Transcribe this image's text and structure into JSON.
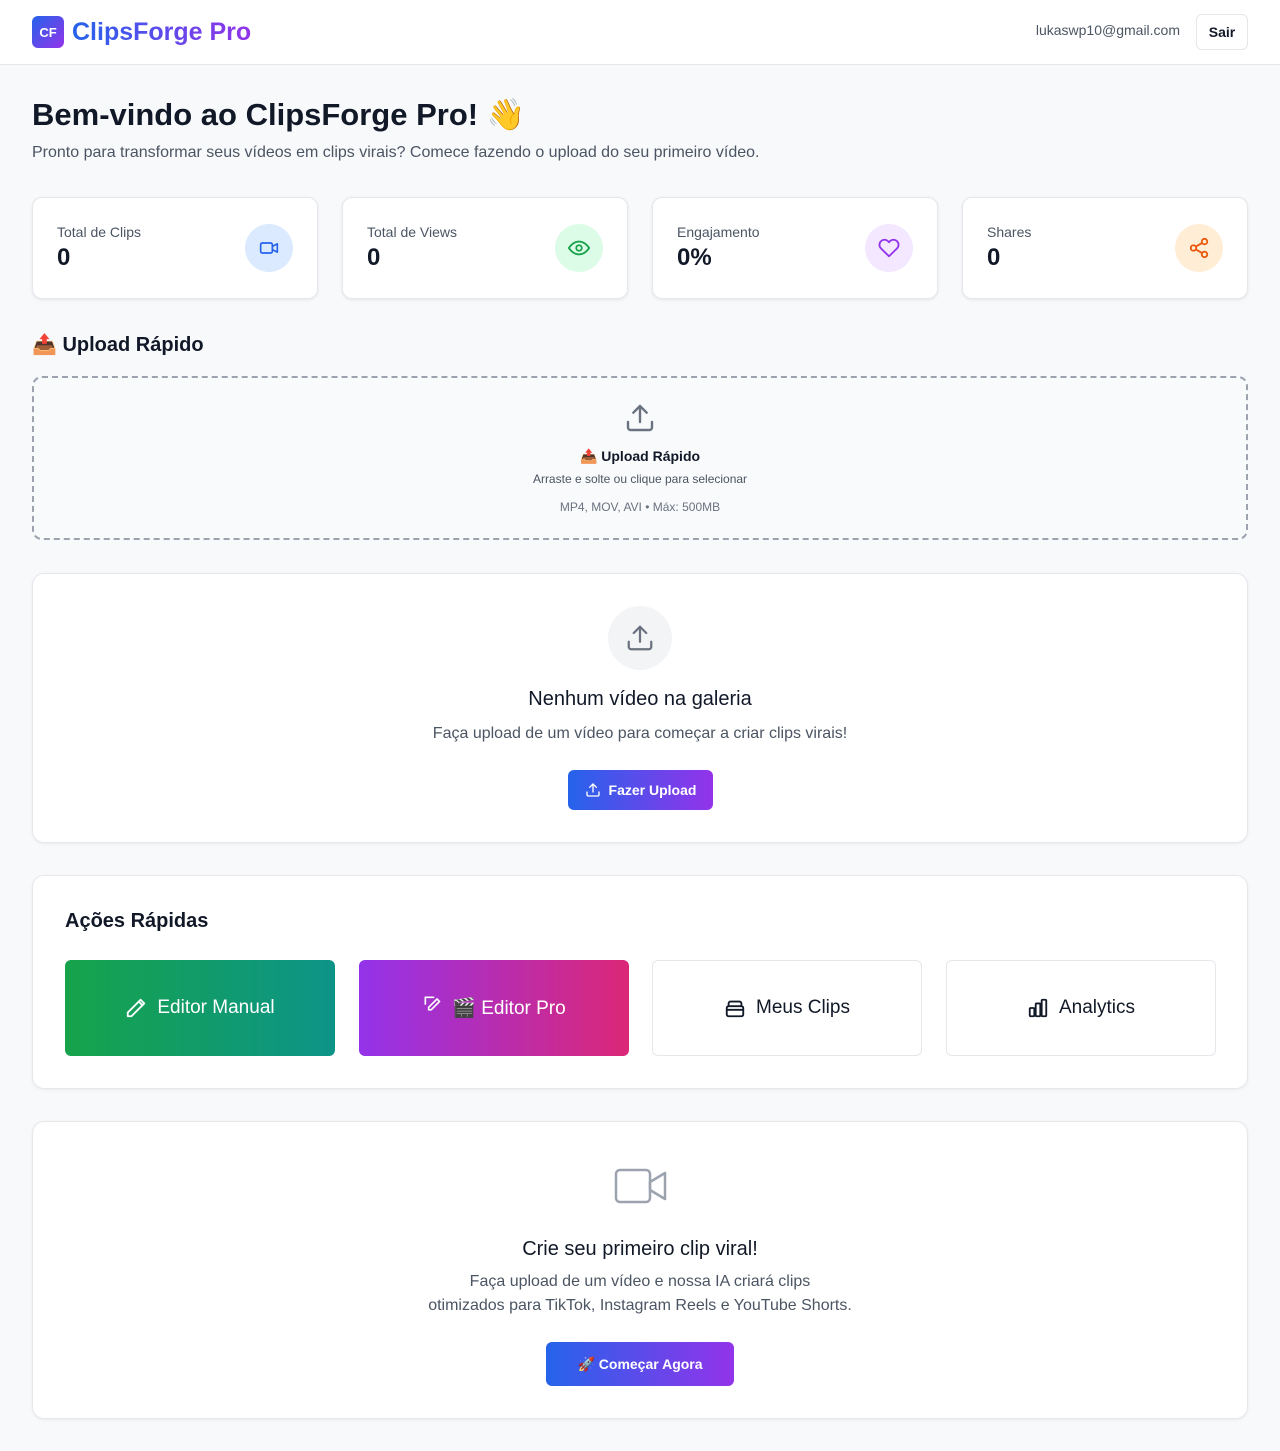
{
  "header": {
    "logo_badge": "CF",
    "app_name": "ClipsForge Pro",
    "user_email": "lukaswp10@gmail.com",
    "logout_label": "Sair"
  },
  "welcome": {
    "title": "Bem-vindo ao ClipsForge Pro! 👋",
    "subtitle": "Pronto para transformar seus vídeos em clips virais? Comece fazendo o upload do seu primeiro vídeo."
  },
  "stats": [
    {
      "label": "Total de Clips",
      "value": "0",
      "icon": "video-icon",
      "color": "#2563eb",
      "bg": "#dbeafe"
    },
    {
      "label": "Total de Views",
      "value": "0",
      "icon": "eye-icon",
      "color": "#16a34a",
      "bg": "#dcfce7"
    },
    {
      "label": "Engajamento",
      "value": "0%",
      "icon": "heart-icon",
      "color": "#9333ea",
      "bg": "#f3e8ff"
    },
    {
      "label": "Shares",
      "value": "0",
      "icon": "share-icon",
      "color": "#ea580c",
      "bg": "#ffedd5"
    }
  ],
  "upload": {
    "section_title": "📤 Upload Rápido",
    "dropzone_title": "📤 Upload Rápido",
    "dropzone_sub": "Arraste e solte ou clique para selecionar",
    "formats": "MP4, MOV, AVI • Máx: 500MB"
  },
  "gallery": {
    "title": "Nenhum vídeo na galeria",
    "subtitle": "Faça upload de um vídeo para começar a criar clips virais!",
    "button_label": "Fazer Upload"
  },
  "quick_actions": {
    "title": "Ações Rápidas",
    "items": [
      {
        "label": "Editor Manual",
        "icon": "pencil-icon"
      },
      {
        "label": "🎬 Editor Pro",
        "icon": "edit-pro-icon"
      },
      {
        "label": "Meus Clips",
        "icon": "archive-icon"
      },
      {
        "label": "Analytics",
        "icon": "bar-chart-icon"
      }
    ]
  },
  "cta": {
    "title": "Crie seu primeiro clip viral!",
    "line1": "Faça upload de um vídeo e nossa IA criará clips",
    "line2": "otimizados para TikTok, Instagram Reels e YouTube Shorts.",
    "button_label": "🚀 Começar Agora"
  },
  "colors": {
    "brand_start": "#2563eb",
    "brand_end": "#9333ea",
    "green_start": "#16a34a",
    "green_end": "#0d9488",
    "pink_end": "#db2777"
  }
}
